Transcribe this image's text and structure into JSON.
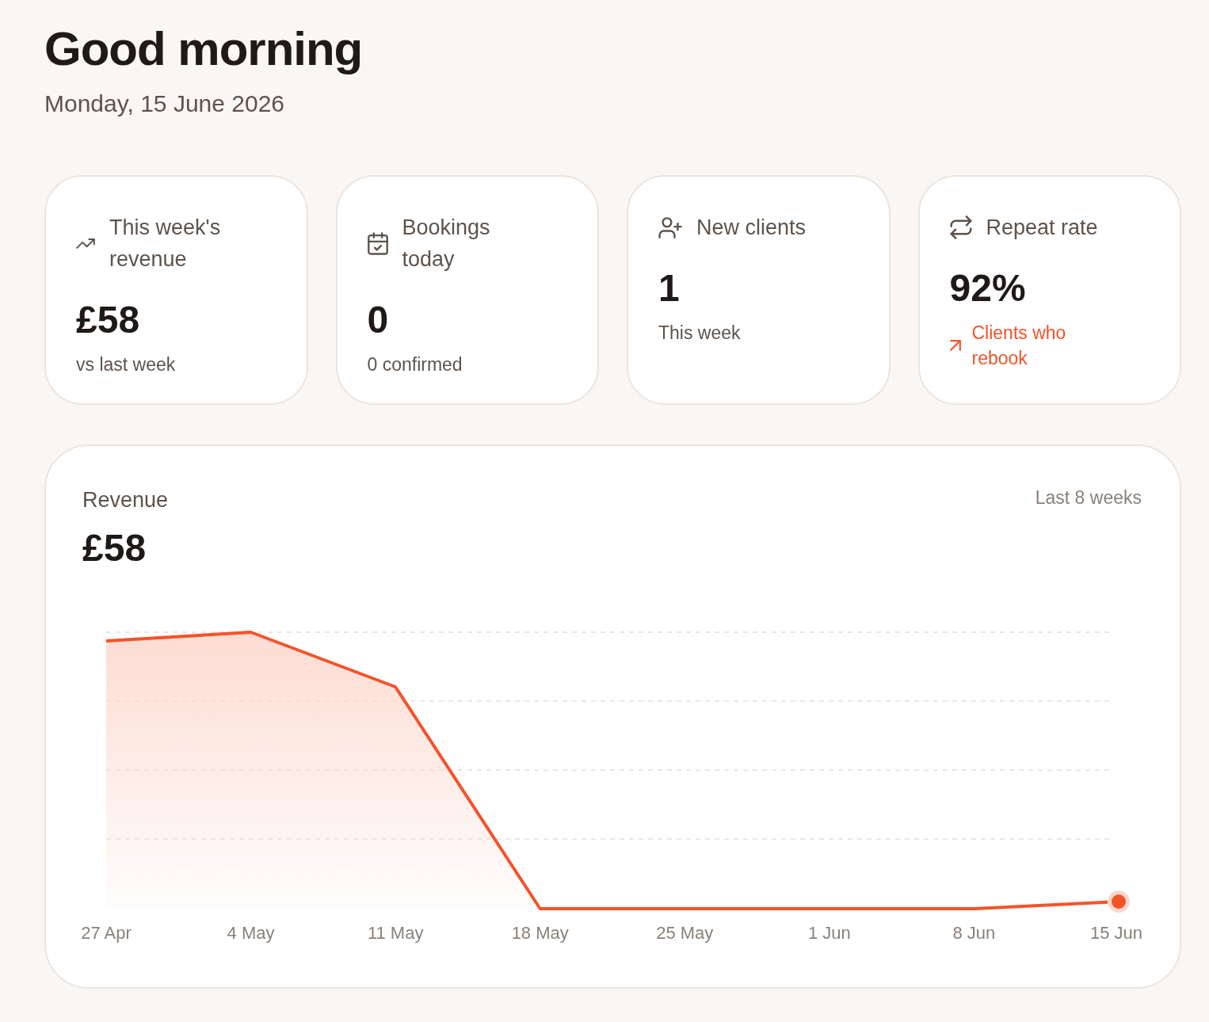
{
  "greeting": {
    "title": "Good morning",
    "date": "Monday, 15 June 2026"
  },
  "stat_cards": [
    {
      "label": "This week's revenue",
      "value": "£58",
      "note": {
        "text": "vs last week",
        "kind": "plain"
      }
    },
    {
      "label": "Bookings today",
      "value": "0",
      "note": {
        "text": "0 confirmed",
        "kind": "plain"
      }
    },
    {
      "label": "New clients",
      "value": "1",
      "note": {
        "text": "This week",
        "kind": "plain"
      }
    },
    {
      "label": "Repeat rate",
      "value": "92%",
      "note": {
        "text": "Clients who rebook",
        "kind": "positive"
      }
    }
  ],
  "revenue_chart": {
    "title": "Revenue",
    "value": "£58",
    "period": "Last 8 weeks",
    "x_labels": [
      "27 Apr",
      "4 May",
      "11 May",
      "18 May",
      "25 May",
      "1 Jun",
      "8 Jun",
      "15 Jun"
    ]
  }
}
